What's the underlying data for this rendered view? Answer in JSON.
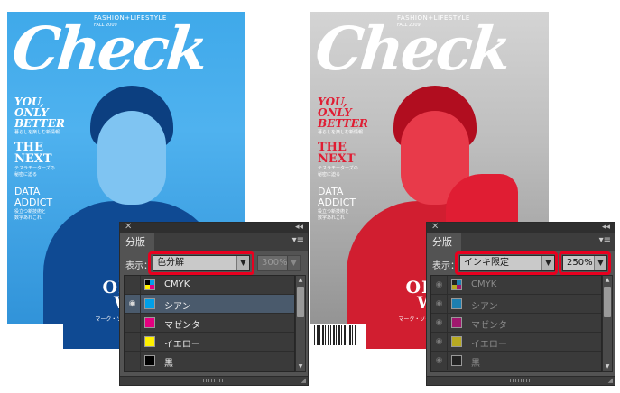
{
  "covers": {
    "left": {
      "masthead": "Check",
      "tagline": "FASHION+LIFESTYLE",
      "issue": "FALL 2009",
      "blurb1_title": [
        "YOU,",
        "ONLY",
        "BETTER"
      ],
      "blurb1_sub": "暮らしを楽しむ新情報",
      "blurb2_title": [
        "THE",
        "NEXT"
      ],
      "blurb2_sub": [
        "テスラモーターズの",
        "秘密に迫る"
      ],
      "blurb3_title": [
        "DATA",
        "ADDICT"
      ],
      "blurb3_sub": [
        "役立つ新技術と",
        "数字あれこれ"
      ],
      "feature_title": [
        "OPER",
        "WO"
      ],
      "feature_sub": "マーク・ソーザ、映画「ダブル・"
    },
    "right": {
      "masthead": "Check",
      "tagline": "FASHION+LIFESTYLE",
      "issue": "FALL 2009",
      "blurb1_title": [
        "YOU,",
        "ONLY",
        "BETTER"
      ],
      "blurb1_sub": "暮らしを楽しむ新情報",
      "blurb2_title": [
        "THE",
        "NEXT"
      ],
      "blurb2_sub": [
        "テスラモーターズの",
        "秘密に迫る"
      ],
      "blurb3_title": [
        "DATA",
        "ADDICT"
      ],
      "blurb3_sub": [
        "役立つ新技術と",
        "数字あれこれ"
      ],
      "feature_title": [
        "OPER",
        "WO"
      ],
      "feature_sub": "マーク・ソーザ、映画「ダブル・"
    }
  },
  "panel_left": {
    "title": "分版",
    "display_label": "表示：",
    "mode": "色分解",
    "zoom": "300%",
    "inks": [
      {
        "name": "CMYK",
        "color": "cmyk",
        "eye": false
      },
      {
        "name": "シアン",
        "color": "#00a0e9",
        "eye": true
      },
      {
        "name": "マゼンタ",
        "color": "#e4007f",
        "eye": false
      },
      {
        "name": "イエロー",
        "color": "#fff100",
        "eye": false
      },
      {
        "name": "黒",
        "color": "#000000",
        "eye": false
      }
    ]
  },
  "panel_right": {
    "title": "分版",
    "display_label": "表示：",
    "mode": "インキ限定",
    "zoom": "250%",
    "inks": [
      {
        "name": "CMYK",
        "color": "cmyk",
        "eye": true
      },
      {
        "name": "シアン",
        "color": "#1e7fb0",
        "eye": true
      },
      {
        "name": "マゼンタ",
        "color": "#a0186e",
        "eye": true
      },
      {
        "name": "イエロー",
        "color": "#b8aa22",
        "eye": true
      },
      {
        "name": "黒",
        "color": "#222222",
        "eye": true
      }
    ]
  },
  "icons": {
    "close": "✕",
    "collapse": "◂◂",
    "panel_menu": "▾≡",
    "eye": "◉",
    "dropdown": "▼",
    "scroll_up": "▲",
    "scroll_down": "▼",
    "resize": "◢"
  }
}
